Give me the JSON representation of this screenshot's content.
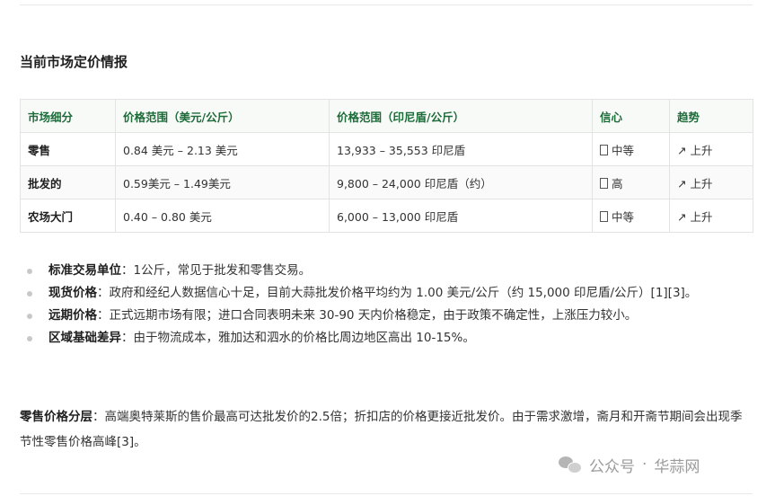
{
  "heading": "当前市场定价情报",
  "table": {
    "headers": [
      "市场细分",
      "价格范围（美元/公斤）",
      "价格范围（印尼盾/公斤）",
      "信心",
      "趋势"
    ],
    "rows": [
      {
        "segment": "零售",
        "usd": "0.84 美元 – 2.13 美元",
        "idr": "13,933 – 35,553 印尼盾",
        "confidence": "中等",
        "trend": "↗ 上升"
      },
      {
        "segment": "批发的",
        "usd": "0.59美元 – 1.49美元",
        "idr": "9,800 – 24,000 印尼盾（约）",
        "confidence": "高",
        "trend": "↗ 上升"
      },
      {
        "segment": "农场大门",
        "usd": "0.40 – 0.80 美元",
        "idr": "6,000 – 13,000 印尼盾",
        "confidence": "中等",
        "trend": "↗ 上升"
      }
    ]
  },
  "bullets": [
    {
      "term": "标准交易单位",
      "text": "：1公斤，常见于批发和零售交易。"
    },
    {
      "term": "现货价格",
      "text": "：政府和经纪人数据信心十足，目前大蒜批发价格平均约为 1.00 美元/公斤（约 15,000 印尼盾/公斤）[1][3]。"
    },
    {
      "term": "远期价格",
      "text": "：正式远期市场有限；进口合同表明未来 30-90 天内价格稳定，由于政策不确定性，上涨压力较小。"
    },
    {
      "term": "区域基础差异",
      "text": "：由于物流成本，雅加达和泗水的价格比周边地区高出 10-15%。"
    }
  ],
  "tier": {
    "term": "零售价格分层",
    "text": "：高端奥特莱斯的售价最高可达批发价的2.5倍；折扣店的价格更接近批发价。由于需求激增，斋月和开斋节期间会出现季节性零售价格高峰[3]。"
  },
  "watermark": {
    "label": "公众号",
    "separator": "·",
    "name": "华蒜网"
  }
}
